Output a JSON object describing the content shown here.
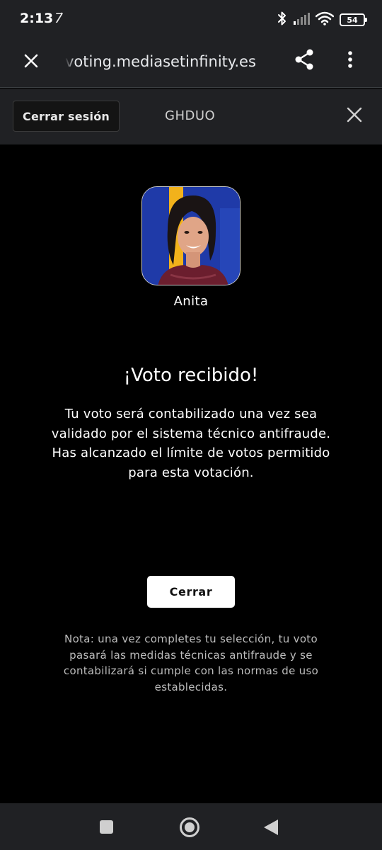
{
  "status_bar": {
    "time": "2:13",
    "extra": "7̇",
    "battery": "54",
    "icons": [
      "bluetooth-icon",
      "signal-icon",
      "wifi-icon",
      "battery-icon"
    ]
  },
  "browser": {
    "url": "voting.mediasetinfinity.es",
    "icons": [
      "close-icon",
      "share-icon",
      "more-vert-icon"
    ]
  },
  "header": {
    "logout_label": "Cerrar sesión",
    "user_code": "GHDUO"
  },
  "contestant": {
    "name": "Anita"
  },
  "confirmation": {
    "title": "¡Voto recibido!",
    "message_lines": [
      "Tu voto será contabilizado una vez sea",
      "validado por el sistema técnico antifraude.",
      "Has alcanzado el límite de votos permitido",
      "para esta votación."
    ]
  },
  "close_label": "Cerrar",
  "note_lines": [
    "Nota: una vez completes tu selección, tu voto",
    "pasará las medidas técnicas antifraude y se",
    "contabilizará si cumple con las normas de uso",
    "establecidas."
  ],
  "colors": {
    "background": "#000000",
    "toolbar": "#202124",
    "avatar_bg": "#1f3aa8",
    "avatar_stripe": "#f2b21b"
  }
}
